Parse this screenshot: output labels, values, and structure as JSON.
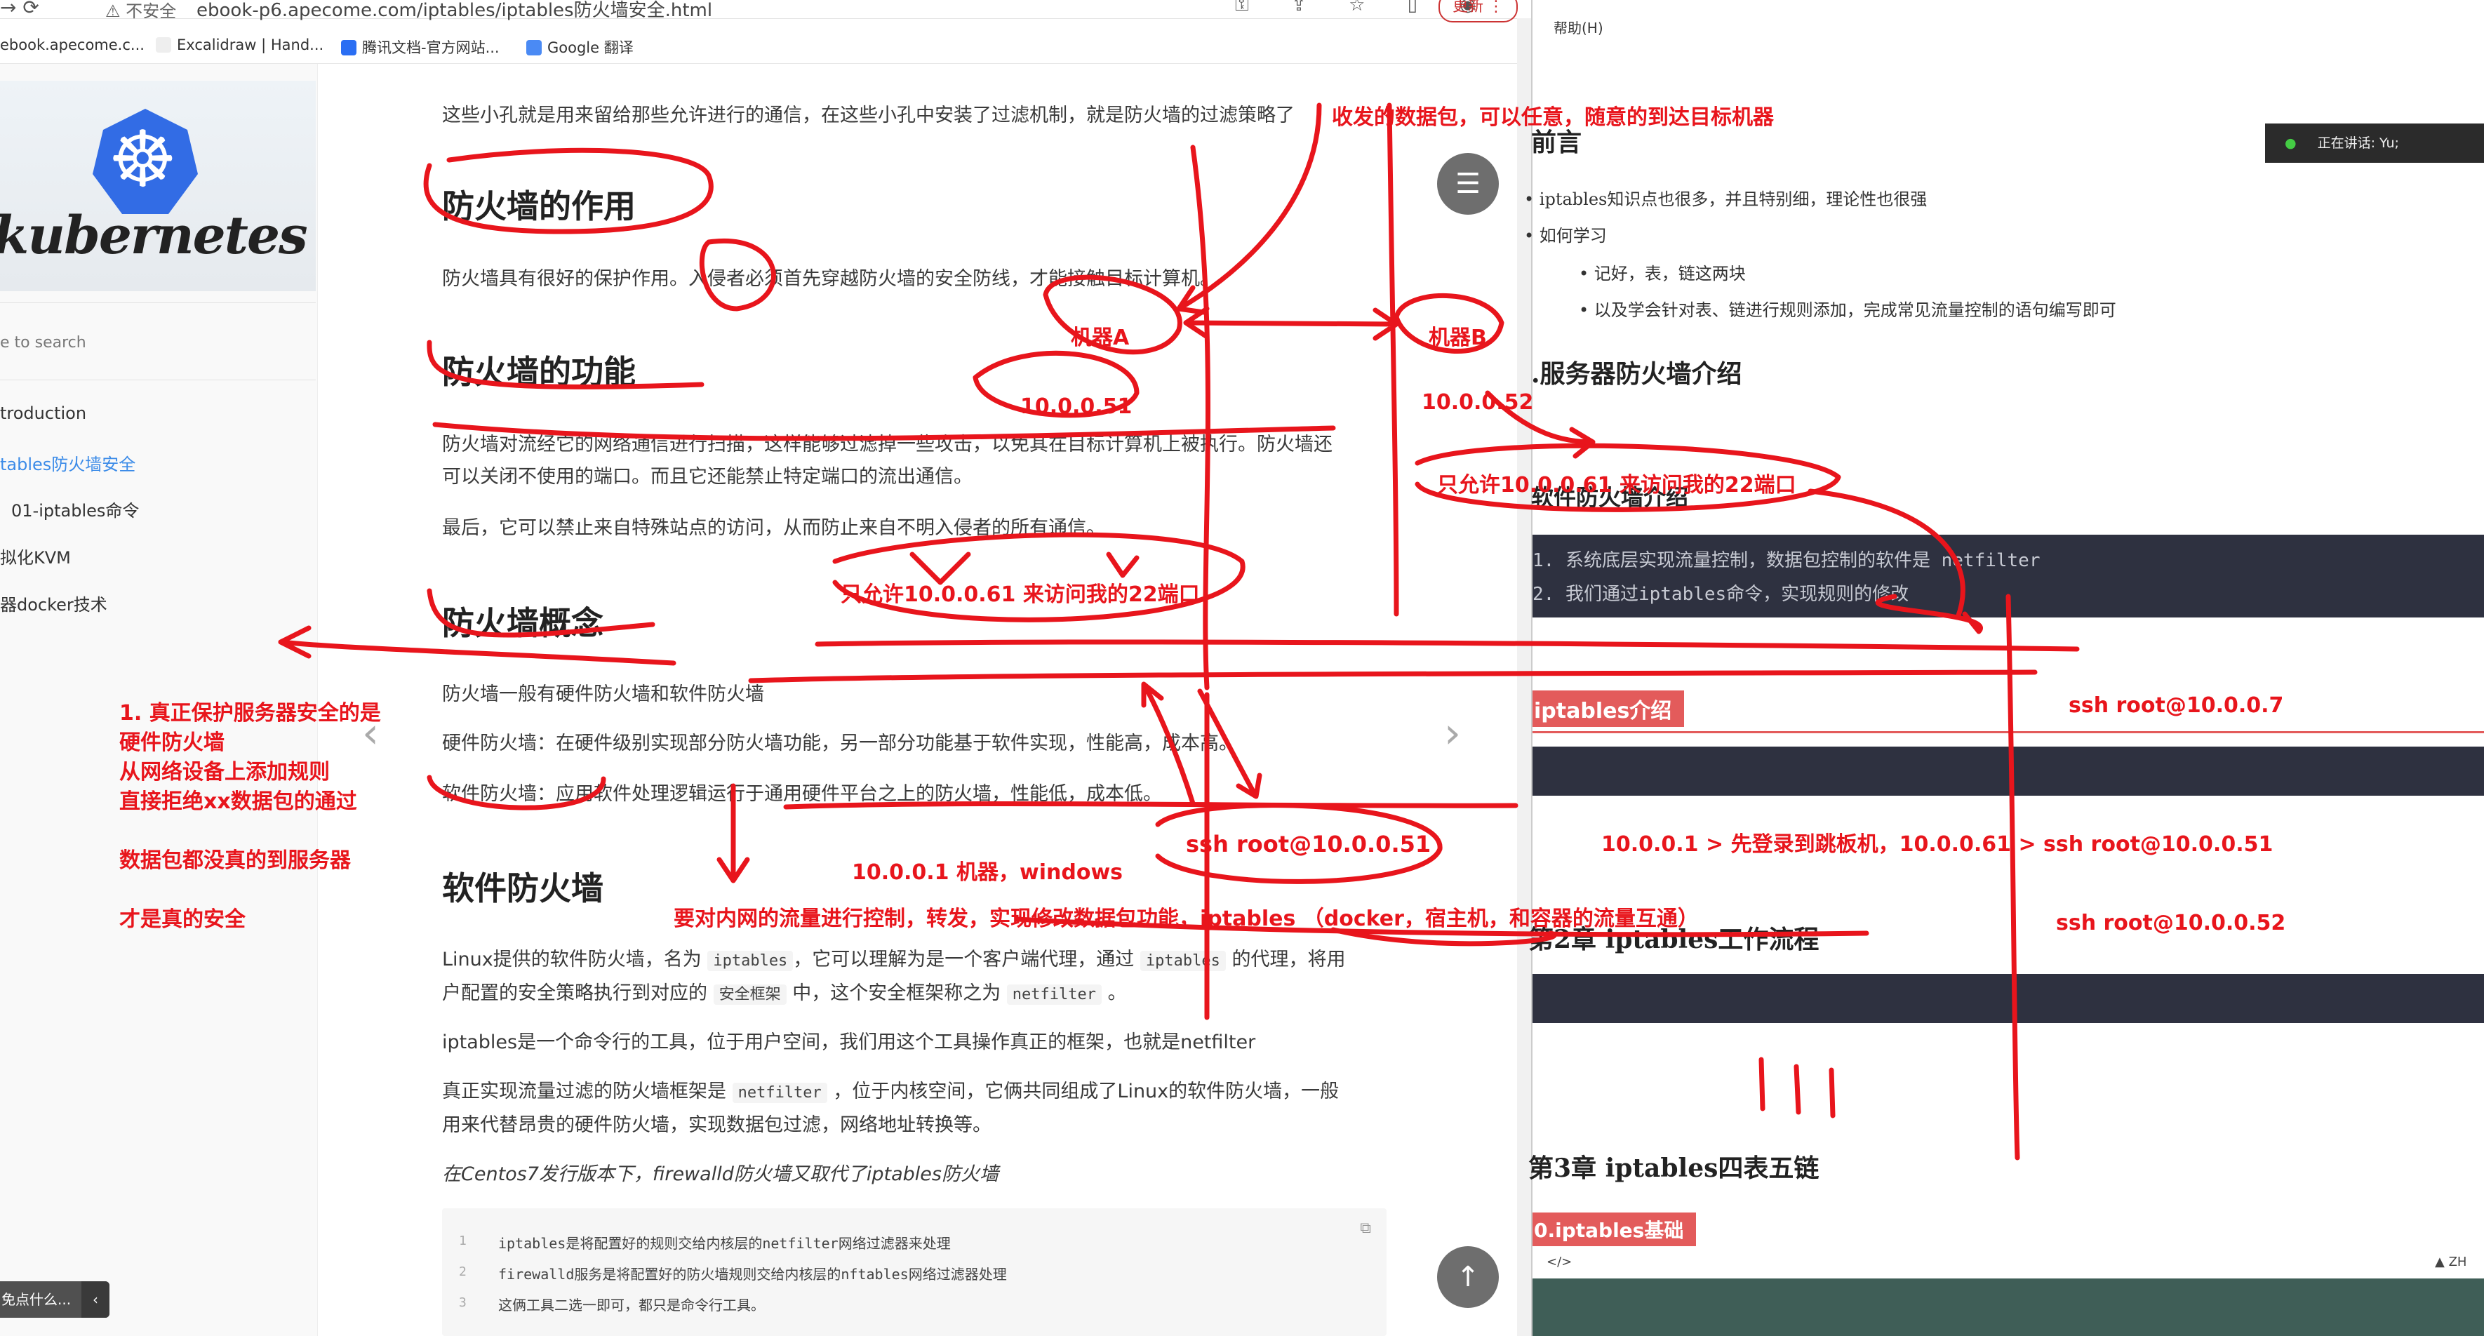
{
  "browser": {
    "nav_glyphs": "→  ⟳",
    "insecure_label": "⚠ 不安全",
    "url": "ebook-p6.apecome.com/iptables/iptables防火墙安全.html",
    "toolbar_icons": "⚿ ⇪ ☆ ▯ ◉",
    "update_button": "更新 ⋮",
    "bookmarks": [
      "ebook.apecome.c...",
      "Excalidraw | Hand...",
      "腾讯文档-官方网站...",
      "Google 翻译"
    ]
  },
  "sidebar": {
    "search_placeholder": "e to search",
    "items": [
      {
        "label": "troduction",
        "active": false
      },
      {
        "label": "tables防火墙安全",
        "active": true
      },
      {
        "label": "01-iptables命令",
        "active": false
      },
      {
        "label": "拟化KVM",
        "active": false
      },
      {
        "label": "器docker技术",
        "active": false
      }
    ],
    "bottom_label": "免点什么...",
    "bottom_chevron": "‹",
    "logo_text": "kubernetes"
  },
  "article": {
    "intro_line": "这些小孔就是用来留给那些允许进行的通信，在这些小孔中安装了过滤机制，就是防火墙的过滤策略了",
    "h_role": "防火墙的作用",
    "p_role": "防火墙具有很好的保护作用。入侵者必须首先穿越防火墙的安全防线，才能接触目标计算机。",
    "h_func": "防火墙的功能",
    "p_func1": "防火墙对流经它的网络通信进行扫描，这样能够过滤掉一些攻击，以免其在目标计算机上被执行。防火墙还",
    "p_func2": "可以关闭不使用的端口。而且它还能禁止特定端口的流出通信。",
    "p_func3": "最后，它可以禁止来自特殊站点的访问，从而防止来自不明入侵者的所有通信。",
    "h_concept": "防火墙概念",
    "p_concept": "防火墙一般有硬件防火墙和软件防火墙",
    "p_hw": "硬件防火墙：在硬件级别实现部分防火墙功能，另一部分功能基于软件实现，性能高，成本高。",
    "p_sw": "软件防火墙：应用软件处理逻辑运行于通用硬件平台之上的防火墙，性能低，成本低。",
    "h_software": "软件防火墙",
    "p_linux_a": "Linux提供的软件防火墙，名为",
    "p_linux_b": "，它可以理解为是一个客户端代理，通过",
    "p_linux_c": "的代理，将用",
    "p_linux2_a": "户配置的安全策略执行到对应的",
    "p_linux2_b": "中，这个安全框架称之为",
    "p_linux2_c": "。",
    "code_iptables": "iptables",
    "code_secframe": "安全框架",
    "code_netfilter": "netfilter",
    "p_cmd": "iptables是一个命令行的工具，位于用户空间，我们用这个工具操作真正的框架，也就是netfilter",
    "p_real1_a": "真正实现流量过滤的防火墙框架是",
    "p_real1_b": "，位于内核空间，它俩共同组成了Linux的软件防火墙，一般",
    "p_real2": "用来代替昂贵的硬件防火墙，实现数据包过滤，网络地址转换等。",
    "p_centos": "在Centos7发行版本下，firewalld防火墙又取代了iptables防火墙",
    "code_lines": [
      {
        "n": "1",
        "t": "iptables是将配置好的规则交给内核层的netfilter网络过滤器来处理"
      },
      {
        "n": "2",
        "t": "firewalld服务是将配置好的防火墙规则交给内核层的nftables网络过滤器处理"
      },
      {
        "n": "3",
        "t": "这俩工具二选一即可，都只是命令行工具。"
      }
    ],
    "copy_icon": "⧉",
    "menu_glyph": "☰",
    "top_glyph": "↑",
    "prev_glyph": "‹",
    "next_glyph": "›"
  },
  "right": {
    "menu_help": "帮助(H)",
    "speaking": "正在讲话: Yu;",
    "h_preface": "前言",
    "b1": "iptables知识点也很多，并且特别细，理论性也很强",
    "b2": "如何学习",
    "b3": "记好，表，链这两块",
    "b4": "以及学会针对表、链进行规则添加，完成常见流量控制的语句编写即可",
    "h_server": ".服务器防火墙介绍",
    "h_soft": "软件防火墙介绍",
    "code1": "1.  系统底层实现流量控制，数据包控制的软件是 netfilter",
    "code2": "2.  我们通过iptables命令，实现规则的修改",
    "tag_intro": "iptables介绍",
    "h_ch2": "第2章 iptables工作流程",
    "h_ch3": "第3章 iptables四表五链",
    "tag_basic": "0.iptables基础",
    "status_left": "</>",
    "status_right": "▲ ZH"
  },
  "annotations": {
    "top": "收发的数据包，可以任意，随意的到达目标机器",
    "machine_a": "机器A",
    "machine_b": "机器B",
    "ip_a": "10.0.0.51",
    "ip_b": "10.0.0.52",
    "allow_right": "只允许10.0.0.61 来访问我的22端口",
    "allow_mid": "只允许10.0.0.61 来访问我的22端口",
    "left_note": "1. 真正保护服务器安全的是\n硬件防火墙\n从网络设备上添加规则\n直接拒绝xx数据包的通过\n\n数据包都没真的到服务器\n\n才是真的安全",
    "ssh51": "ssh root@10.0.0.51",
    "win_ip": "10.0.0.1 机器，windows",
    "iptables_note": "要对内网的流量进行控制，转发，实现修改数据包功能，iptables （docker，宿主机，和容器的流量互通）",
    "ssh7": "ssh root@10.0.0.7",
    "jump": "10.0.0.1  > 先登录到跳板机，10.0.0.61  >  ssh root@10.0.0.51",
    "ssh52": "ssh root@10.0.0.52"
  }
}
